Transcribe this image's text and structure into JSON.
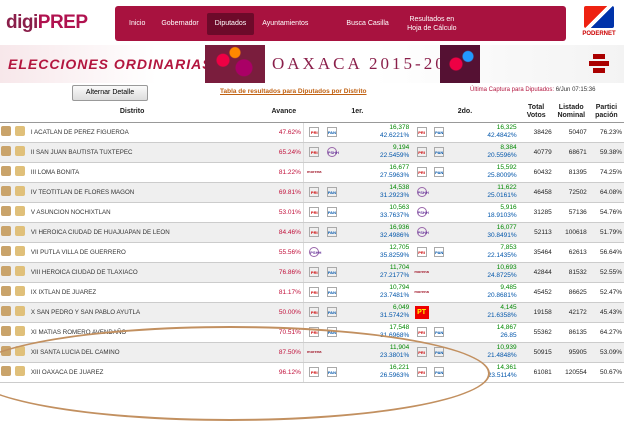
{
  "header": {
    "logo_a": "digi",
    "logo_b": "PREP",
    "nav": [
      {
        "label": "Inicio",
        "active": false
      },
      {
        "label": "Gobernador",
        "active": false
      },
      {
        "label": "Diputados",
        "active": true
      },
      {
        "label": "Ayuntamientos",
        "active": false
      },
      {
        "label": "Busca Casilla",
        "active": false
      },
      {
        "label": "Resultados en Hoja de Cálculo",
        "active": false
      }
    ],
    "podernet_label": "PODERNET"
  },
  "banner": {
    "left_title": "ELECCIONES ORDINARIAS",
    "right_title": "OAXACA 2015-2016"
  },
  "toolbar": {
    "button_label": "Alternar Detalle",
    "table_title": "Tabla de resultados para Diputados por Distrito",
    "last_capture_label": "Última Captura para Diputados:",
    "last_capture_value": "6/Jun 07:15:36"
  },
  "columns": {
    "distrito": "Distrito",
    "avance": "Avance",
    "primero": "1er.",
    "segundo": "2do.",
    "total": "Total Votos",
    "listado": "Listado Nominal",
    "participacion": "Partici pación"
  },
  "rows": [
    {
      "distrito": "I ACATLAN DE PEREZ FIGUEROA",
      "avance": "47.62%",
      "p1": "PRI",
      "p1a": "PAN",
      "v1": "16,378",
      "pc1": "42.6221%",
      "p2": "PRI",
      "p2a": "PAN",
      "v2": "16,325",
      "pc2": "42.4842%",
      "total": "38426",
      "listado": "50407",
      "part": "76.23%"
    },
    {
      "distrito": "II SAN JUAN BAUTISTA TUXTEPEC",
      "avance": "65.24%",
      "p1": "PRI",
      "p1a": "PSHH",
      "v1": "9,194",
      "pc1": "22.5459%",
      "p2": "PRI",
      "p2a": "PAN",
      "v2": "8,384",
      "pc2": "20.5596%",
      "total": "40779",
      "listado": "68671",
      "part": "59.38%"
    },
    {
      "distrito": "III LOMA BONITA",
      "avance": "81.22%",
      "p1": "morena",
      "p1a": "",
      "v1": "16,677",
      "pc1": "27.5963%",
      "p2": "PRI",
      "p2a": "PAN",
      "v2": "15,592",
      "pc2": "25.8009%",
      "total": "60432",
      "listado": "81395",
      "part": "74.25%"
    },
    {
      "distrito": "IV TEOTITLAN DE FLORES MAGON",
      "avance": "69.81%",
      "p1": "PRI",
      "p1a": "PAN",
      "v1": "14,538",
      "pc1": "31.2923%",
      "p2": "PSHH",
      "p2a": "",
      "v2": "11,622",
      "pc2": "25.0161%",
      "total": "46458",
      "listado": "72502",
      "part": "64.08%"
    },
    {
      "distrito": "V ASUNCION NOCHIXTLAN",
      "avance": "53.01%",
      "p1": "PRI",
      "p1a": "PAN",
      "v1": "10,563",
      "pc1": "33.7637%",
      "p2": "PSHH",
      "p2a": "",
      "v2": "5,916",
      "pc2": "18.9103%",
      "total": "31285",
      "listado": "57136",
      "part": "54.76%"
    },
    {
      "distrito": "VI HEROICA CIUDAD DE HUAJUAPAN DE LEON",
      "avance": "84.46%",
      "p1": "PRI",
      "p1a": "PAN",
      "v1": "16,936",
      "pc1": "32.4986%",
      "p2": "PSHH",
      "p2a": "",
      "v2": "16,077",
      "pc2": "30.8491%",
      "total": "52113",
      "listado": "100618",
      "part": "51.79%"
    },
    {
      "distrito": "VII PUTLA VILLA DE GUERRERO",
      "avance": "55.56%",
      "p1": "PSHH",
      "p1a": "",
      "v1": "12,705",
      "pc1": "35.8259%",
      "p2": "PRI",
      "p2a": "PAN",
      "v2": "7,853",
      "pc2": "22.1435%",
      "total": "35464",
      "listado": "62613",
      "part": "56.64%"
    },
    {
      "distrito": "VIII HEROICA CIUDAD DE TLAXIACO",
      "avance": "76.86%",
      "p1": "PRI",
      "p1a": "PAN",
      "v1": "11,704",
      "pc1": "27.2177%",
      "p2": "morena",
      "p2a": "",
      "v2": "10,693",
      "pc2": "24.8725%",
      "total": "42844",
      "listado": "81532",
      "part": "52.55%"
    },
    {
      "distrito": "IX IXTLAN DE JUAREZ",
      "avance": "81.17%",
      "p1": "PRI",
      "p1a": "PAN",
      "v1": "10,794",
      "pc1": "23.7481%",
      "p2": "morena",
      "p2a": "",
      "v2": "9,485",
      "pc2": "20.8681%",
      "total": "45452",
      "listado": "86625",
      "part": "52.47%"
    },
    {
      "distrito": "X SAN PEDRO Y SAN PABLO AYUTLA",
      "avance": "50.00%",
      "p1": "PRI",
      "p1a": "PAN",
      "v1": "6,049",
      "pc1": "31.5742%",
      "p2": "PT",
      "p2a": "",
      "v2": "4,145",
      "pc2": "21.6358%",
      "total": "19158",
      "listado": "42172",
      "part": "45.43%"
    },
    {
      "distrito": "XI MATIAS ROMERO AVENDAÑO",
      "avance": "70.51%",
      "p1": "PRI",
      "p1a": "PAN",
      "v1": "17,548",
      "pc1": "31.6968%",
      "p2": "PRI",
      "p2a": "PAN",
      "v2": "14,867",
      "pc2": "26.85",
      "total": "55362",
      "listado": "86135",
      "part": "64.27%"
    },
    {
      "distrito": "XII SANTA LUCIA DEL CAMINO",
      "avance": "87.50%",
      "p1": "morena",
      "p1a": "",
      "v1": "11,904",
      "pc1": "23.3801%",
      "p2": "PRI",
      "p2a": "PAN",
      "v2": "10,939",
      "pc2": "21.4848%",
      "total": "50915",
      "listado": "95905",
      "part": "53.09%"
    },
    {
      "distrito": "XIII OAXACA DE JUAREZ",
      "avance": "96.12%",
      "p1": "PRI",
      "p1a": "PAN",
      "v1": "16,221",
      "pc1": "26.5963%",
      "p2": "PRI",
      "p2a": "PAN",
      "v2": "14,361",
      "pc2": "23.5114%",
      "total": "61081",
      "listado": "120554",
      "part": "50.67%"
    }
  ]
}
